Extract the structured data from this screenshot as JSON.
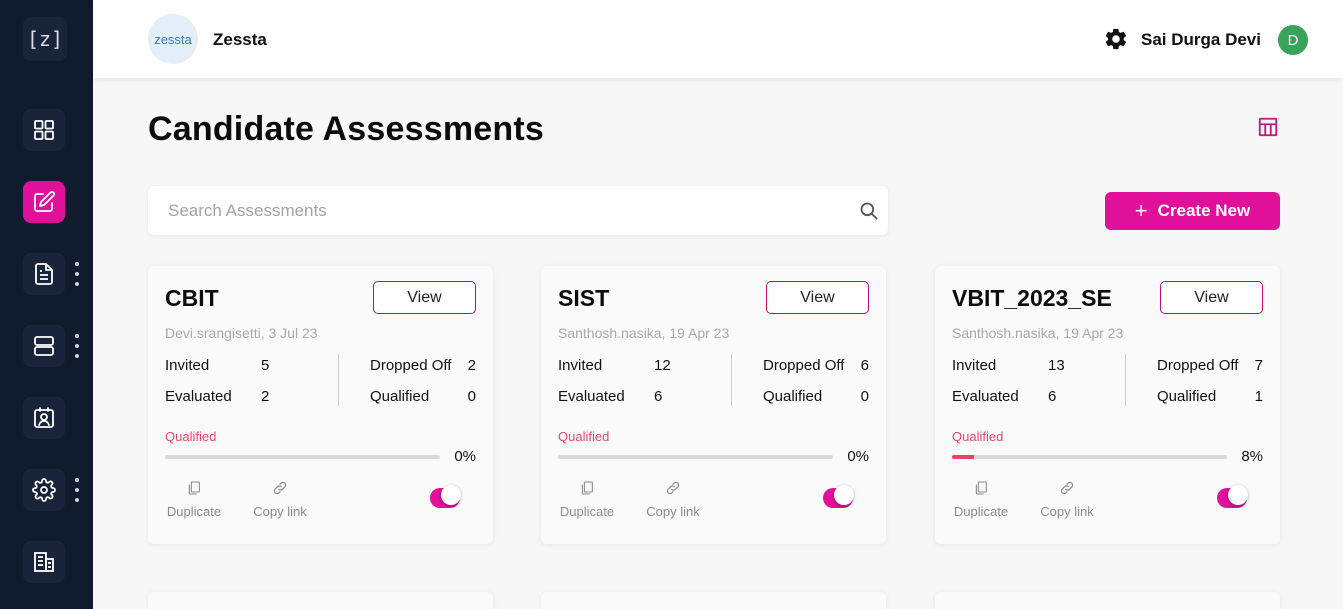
{
  "sidebar": {
    "logo": "[z]",
    "items": [
      {
        "icon": "dashboard-icon",
        "active": false,
        "has_menu": false
      },
      {
        "icon": "edit-icon",
        "active": true,
        "has_menu": false
      },
      {
        "icon": "document-icon",
        "active": false,
        "has_menu": true
      },
      {
        "icon": "server-icon",
        "active": false,
        "has_menu": true
      },
      {
        "icon": "contact-icon",
        "active": false,
        "has_menu": false
      },
      {
        "icon": "settings-icon",
        "active": false,
        "has_menu": true
      },
      {
        "icon": "building-icon",
        "active": false,
        "has_menu": false
      }
    ]
  },
  "header": {
    "org_logo_text": "zessta",
    "org_name": "Zessta",
    "user_name": "Sai Durga Devi",
    "avatar_initial": "D"
  },
  "main": {
    "title": "Candidate Assessments",
    "search_placeholder": "Search Assessments",
    "create_label": "Create New",
    "create_icon": "+"
  },
  "labels": {
    "view": "View",
    "invited": "Invited",
    "evaluated": "Evaluated",
    "dropped_off": "Dropped Off",
    "qualified": "Qualified",
    "qualified_progress": "Qualified",
    "duplicate": "Duplicate",
    "copy_link": "Copy link"
  },
  "cards": [
    {
      "title": "CBIT",
      "meta": "Devi.srangisetti, 3 Jul 23",
      "invited": "5",
      "evaluated": "2",
      "dropped_off": "2",
      "qualified": "0",
      "percent_label": "0%",
      "progress": 0,
      "active": true
    },
    {
      "title": "SIST",
      "meta": "Santhosh.nasika, 19 Apr 23",
      "invited": "12",
      "evaluated": "6",
      "dropped_off": "6",
      "qualified": "0",
      "percent_label": "0%",
      "progress": 0,
      "active": true
    },
    {
      "title": "VBIT_2023_SE",
      "meta": "Santhosh.nasika, 19 Apr 23",
      "invited": "13",
      "evaluated": "6",
      "dropped_off": "7",
      "qualified": "1",
      "percent_label": "8%",
      "progress": 8,
      "active": true
    }
  ],
  "colors": {
    "accent": "#e0109b",
    "sidebar_bg": "#111b2e",
    "progress_fill": "#ee3f66",
    "qualified_label": "#e54a6a",
    "avatar_bg": "#3aa35a"
  }
}
